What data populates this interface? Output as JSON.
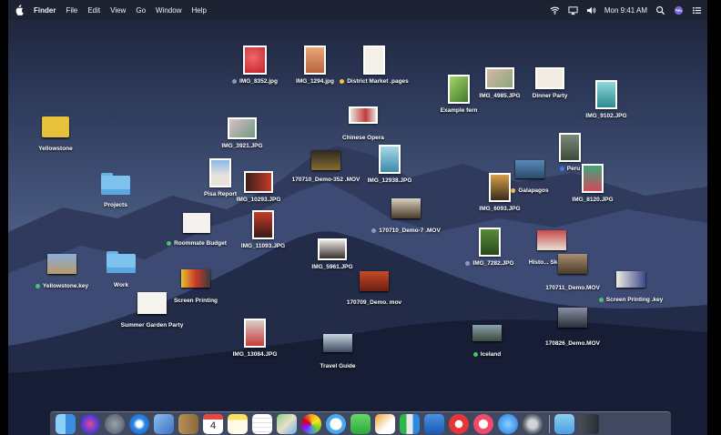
{
  "menubar": {
    "apple_icon": "apple-icon",
    "app_name": "Finder",
    "menus": [
      "File",
      "Edit",
      "View",
      "Go",
      "Window",
      "Help"
    ],
    "status_icons": [
      "wifi-icon",
      "airplay-icon",
      "volume-icon",
      "spotlight-icon",
      "siri-icon",
      "notification-center-icon"
    ],
    "clock": "Mon 9:41 AM"
  },
  "desktop": {
    "items": [
      {
        "label": "IMG_8352.jpg",
        "tag": "#8a9ab8"
      },
      {
        "label": "IMG_1294.jpg"
      },
      {
        "label": "District Market .pages",
        "tag": "#f5c242"
      },
      {
        "label": "Example fern"
      },
      {
        "label": "IMG_4985.JPG"
      },
      {
        "label": "Dinner Party"
      },
      {
        "label": "IMG_9102.JPG"
      },
      {
        "label": "Yellowstone"
      },
      {
        "label": "IMG_3921.JPG"
      },
      {
        "label": "Chinese Opera"
      },
      {
        "label": "Peru",
        "tag": "#3b7fe0"
      },
      {
        "label": "IMG_8120.JPG"
      },
      {
        "label": "Projects"
      },
      {
        "label": "Pisa Report"
      },
      {
        "label": "IMG_10293.JPG"
      },
      {
        "label": "170710_Demo-352 .MOV"
      },
      {
        "label": "IMG_12938.JPG"
      },
      {
        "label": "Galapagos",
        "tag": "#f5c242"
      },
      {
        "label": "IMG_6093.JPG"
      },
      {
        "label": "Roommate Budget",
        "tag": "#4cc26a"
      },
      {
        "label": "IMG_11093.JPG"
      },
      {
        "label": "170710_Demo-7 .MOV",
        "tag": "#8a9ab8"
      },
      {
        "label": "IMG_7282.JPG",
        "tag": "#8a9ab8"
      },
      {
        "label": "Histo... Skateb..."
      },
      {
        "label": "Yellowstone.key",
        "tag": "#4cc26a"
      },
      {
        "label": "Work"
      },
      {
        "label": "Screen Printing"
      },
      {
        "label": "IMG_5961.JPG"
      },
      {
        "label": "170711_Demo.MOV"
      },
      {
        "label": "Screen Printing .key",
        "tag": "#4cc26a"
      },
      {
        "label": "170709_Demo. mov"
      },
      {
        "label": "Summer Garden Party"
      },
      {
        "label": "170826_Demo.MOV"
      },
      {
        "label": "IMG_13084.JPG"
      },
      {
        "label": "Iceland",
        "tag": "#4cc26a"
      },
      {
        "label": "Travel Guide"
      }
    ]
  },
  "dock": {
    "apps": [
      "finder-icon",
      "siri-icon",
      "launchpad-icon",
      "safari-icon",
      "mail-icon",
      "contacts-icon",
      "calendar-icon",
      "notes-icon",
      "reminders-icon",
      "maps-icon",
      "photos-icon",
      "messages-icon",
      "facetime-icon",
      "pages-icon",
      "numbers-icon",
      "keynote-icon",
      "news-icon",
      "music-icon",
      "app-store-icon",
      "system-preferences-icon"
    ],
    "calendar_day": "4",
    "trailing": [
      "downloads-folder-icon",
      "trash-icon"
    ]
  }
}
